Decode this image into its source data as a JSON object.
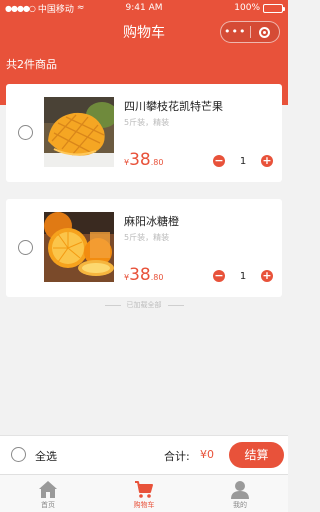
{
  "status_bar": {
    "carrier": "中国移动",
    "time": "9:41 AM",
    "battery": "100%",
    "battery_level": 1.0
  },
  "nav": {
    "title": "购物车",
    "more_glyph": "•••"
  },
  "cart": {
    "item_count_text": "共2件商品",
    "items": [
      {
        "name": "四川攀枝花凯特芒果",
        "spec": "5斤装，精装",
        "currency": "¥",
        "price_int": "38",
        "price_dec": ".80",
        "quantity": "1",
        "image_icon": "mango-image",
        "selected": false
      },
      {
        "name": "麻阳冰糖橙",
        "spec": "5斤装，精装",
        "currency": "¥",
        "price_int": "38",
        "price_dec": ".80",
        "quantity": "1",
        "image_icon": "orange-image",
        "selected": false
      }
    ],
    "minus_glyph": "−",
    "plus_glyph": "+",
    "loaded_all_text": "已加载全部"
  },
  "checkout": {
    "select_all_label": "全选",
    "total_label": "合计:",
    "total_amount": "¥0",
    "checkout_label": "结算"
  },
  "tabbar": {
    "tabs": [
      {
        "label": "首页",
        "icon": "home-icon",
        "active": false
      },
      {
        "label": "购物车",
        "icon": "cart-icon",
        "active": true
      },
      {
        "label": "我的",
        "icon": "user-icon",
        "active": false
      }
    ]
  },
  "colors": {
    "accent": "#e8523a",
    "background": "#f2f2f2",
    "card": "#ffffff"
  }
}
